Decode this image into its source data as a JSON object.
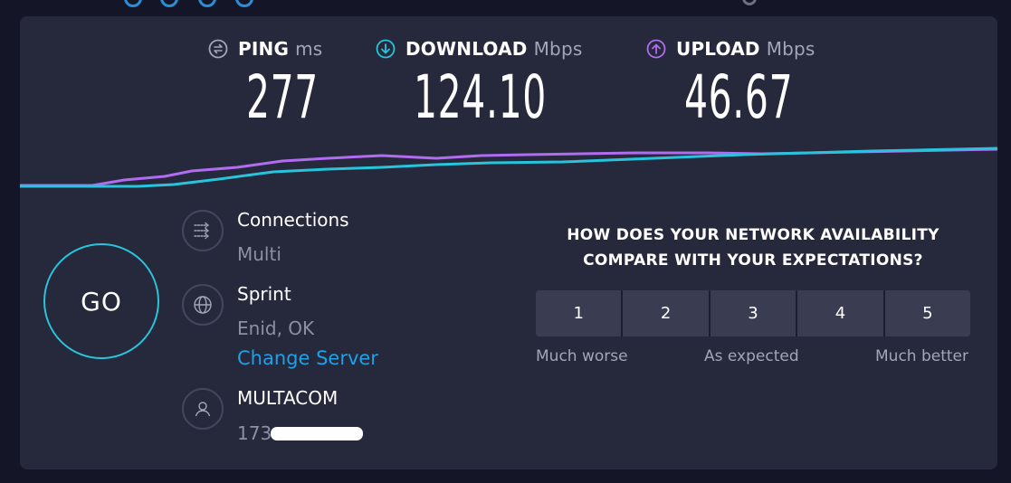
{
  "metrics": {
    "ping": {
      "label": "PING",
      "unit": "ms",
      "value": "277",
      "icon": "ping-icon",
      "color": "#a3a6b8"
    },
    "download": {
      "label": "DOWNLOAD",
      "unit": "Mbps",
      "value": "124.10",
      "icon": "download-arrow-icon",
      "color": "#28c4dc"
    },
    "upload": {
      "label": "UPLOAD",
      "unit": "Mbps",
      "value": "46.67",
      "icon": "upload-arrow-icon",
      "color": "#b16cf0"
    }
  },
  "go_button": {
    "label": "GO",
    "color": "#28c4dc"
  },
  "connections": {
    "title": "Connections",
    "value": "Multi",
    "icon": "connections-icon"
  },
  "server": {
    "title": "Sprint",
    "location": "Enid, OK",
    "change_label": "Change Server",
    "icon": "globe-icon"
  },
  "provider": {
    "title": "MULTACOM",
    "ip_prefix": "173",
    "icon": "user-icon"
  },
  "survey": {
    "question_line1": "HOW DOES YOUR NETWORK AVAILABILITY",
    "question_line2": "COMPARE WITH YOUR EXPECTATIONS?",
    "options": [
      "1",
      "2",
      "3",
      "4",
      "5"
    ],
    "labels": {
      "low": "Much worse",
      "mid": "As expected",
      "high": "Much better"
    }
  }
}
